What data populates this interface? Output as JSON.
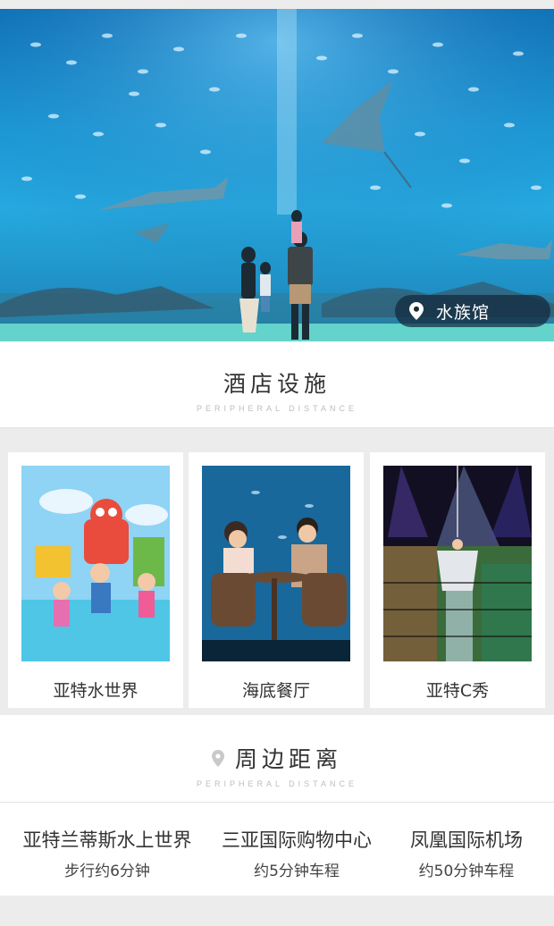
{
  "hero": {
    "location_label": "水族馆"
  },
  "facilities_section": {
    "title": "酒店设施",
    "subtitle": "PERIPHERAL DISTANCE"
  },
  "facilities": [
    {
      "name": "亚特水世界"
    },
    {
      "name": "海底餐厅"
    },
    {
      "name": "亚特C秀"
    }
  ],
  "surroundings_section": {
    "title": "周边距离",
    "subtitle": "PERIPHERAL DISTANCE"
  },
  "distances": [
    {
      "place": "亚特兰蒂斯水上世界",
      "time": "步行约6分钟"
    },
    {
      "place": "三亚国际购物中心",
      "time": "约5分钟车程"
    },
    {
      "place": "凤凰国际机场",
      "time": "约50分钟车程"
    }
  ],
  "colors": {
    "background": "#ececec",
    "card": "#ffffff",
    "text": "#333333",
    "subtitle": "#bdbdbd",
    "pill": "#14283c"
  }
}
